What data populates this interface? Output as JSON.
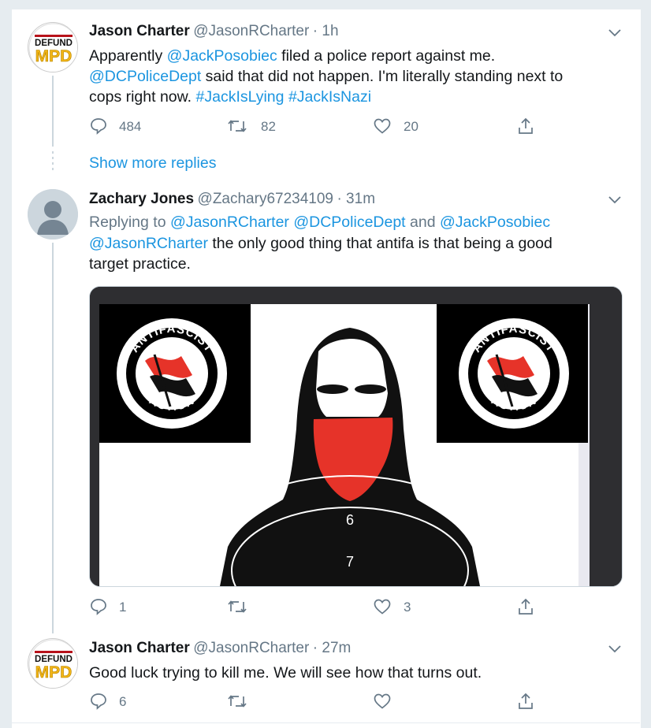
{
  "tweets": [
    {
      "name": "Jason Charter",
      "handle": "@JasonRCharter",
      "time": "· 1h",
      "text_parts": [
        {
          "t": "Apparently ",
          "link": false
        },
        {
          "t": "@JackPosobiec",
          "link": true
        },
        {
          "t": " filed a police report against me.",
          "link": false
        },
        {
          "t": "@DCPoliceDept",
          "link": true
        },
        {
          "t": " said that did not happen. I'm literally standing next to",
          "link": false
        },
        {
          "t": "cops right now. ",
          "link": false
        },
        {
          "t": "#JackIsLying",
          "link": true
        },
        {
          "t": " ",
          "link": false
        },
        {
          "t": "#JackIsNazi",
          "link": true
        }
      ],
      "replies": "484",
      "retweets": "82",
      "likes": "20",
      "avatar_text_top": "DEFUND",
      "avatar_text_bottom": "MPD"
    },
    {
      "name": "Zachary Jones",
      "handle": "@Zachary67234109",
      "time": "· 31m",
      "replying_prefix": "Replying to ",
      "replying_1": "@JasonRCharter",
      "replying_2": "@DCPoliceDept",
      "replying_and": " and ",
      "replying_3": "@JackPosobiec",
      "mention": "@JasonRCharter",
      "text_rest": " the only good thing that antifa is that being a good",
      "text_line2": "target practice.",
      "replies": "1",
      "retweets": "",
      "likes": "3",
      "image": {
        "flag_top": "ANTIFASCIST",
        "flag_bottom": "ACTION",
        "ring6": "6",
        "ring7": "7"
      }
    },
    {
      "name": "Jason Charter",
      "handle": "@JasonRCharter",
      "time": "· 27m",
      "text": "Good luck trying to kill me. We will see how that turns out.",
      "replies": "6",
      "retweets": "",
      "likes": "",
      "avatar_text_top": "DEFUND",
      "avatar_text_bottom": "MPD"
    }
  ],
  "show_more": "Show more replies",
  "colors": {
    "link": "#1b95e0",
    "muted": "#657786",
    "antifa_red": "#e63329"
  }
}
